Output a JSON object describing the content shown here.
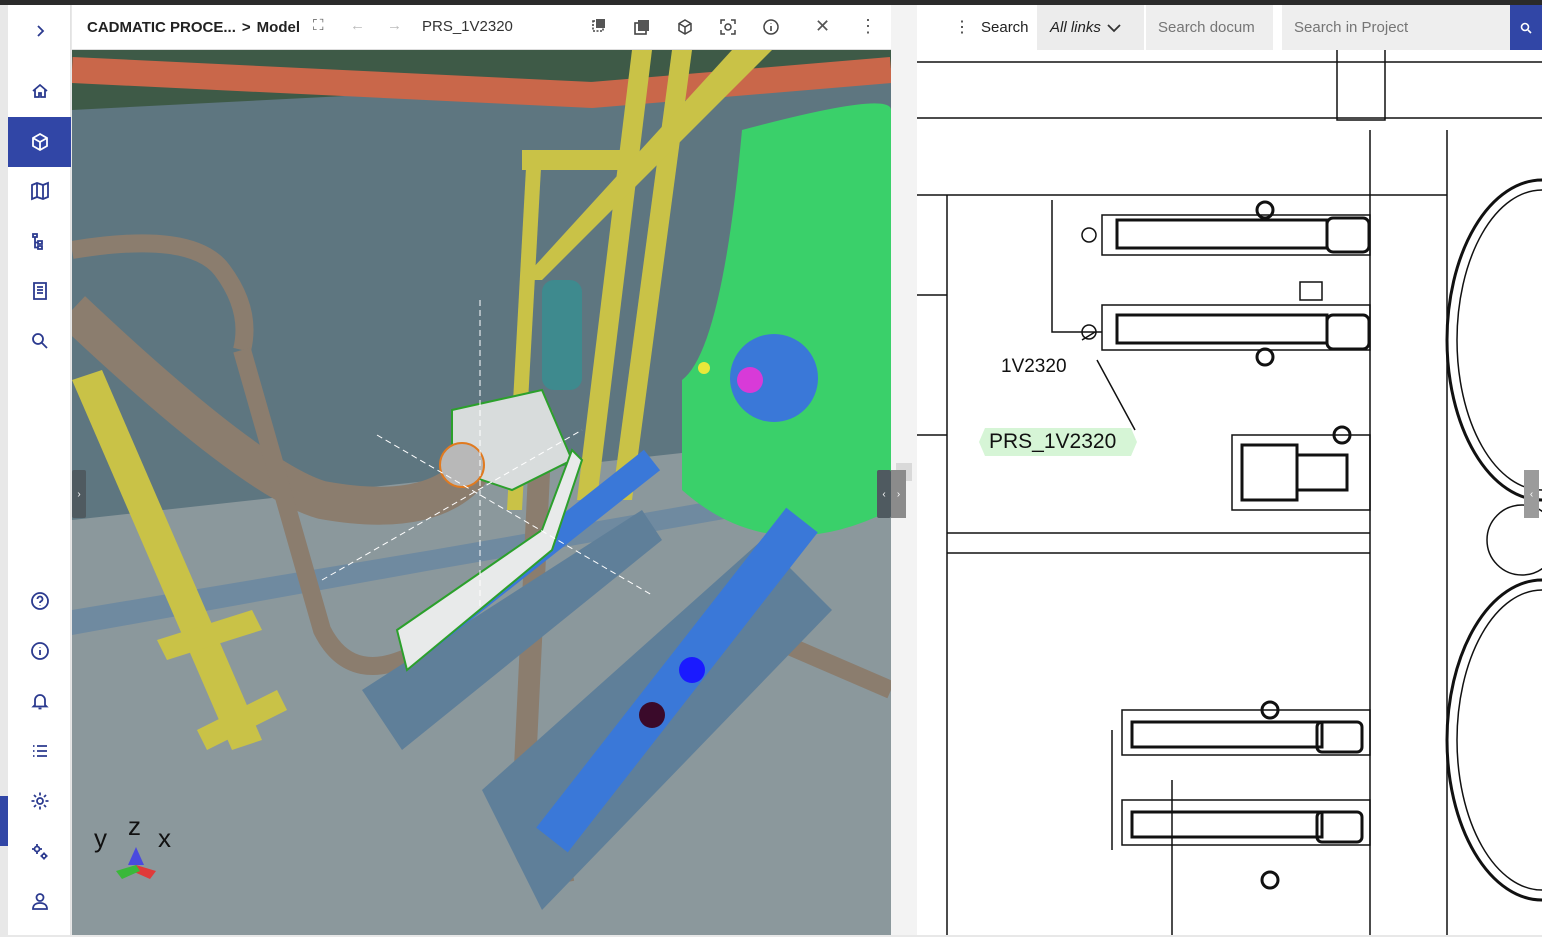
{
  "rail": {
    "expand_icon": "chevron-right-icon",
    "items": [
      {
        "name": "home",
        "icon": "home-icon"
      },
      {
        "name": "model",
        "icon": "cube-icon",
        "active": true
      },
      {
        "name": "map",
        "icon": "map-icon"
      },
      {
        "name": "hierarchy",
        "icon": "tree-icon"
      },
      {
        "name": "documents",
        "icon": "document-icon"
      },
      {
        "name": "search",
        "icon": "search-icon"
      },
      {
        "name": "help",
        "icon": "help-icon"
      },
      {
        "name": "info",
        "icon": "info-icon"
      },
      {
        "name": "notifications",
        "icon": "bell-icon"
      },
      {
        "name": "list",
        "icon": "list-icon"
      },
      {
        "name": "settings",
        "icon": "gear-icon"
      },
      {
        "name": "admin-settings",
        "icon": "gears-icon"
      },
      {
        "name": "account",
        "icon": "user-icon"
      }
    ]
  },
  "model_header": {
    "breadcrumb_root": "CADMATIC PROCE...",
    "breadcrumb_sep": ">",
    "breadcrumb_current": "Model",
    "object_title": "PRS_1V2320"
  },
  "viewport": {
    "axis": {
      "x": "x",
      "y": "y",
      "z": "z"
    }
  },
  "drawing_header": {
    "search_label": "Search",
    "links_filter": "All links",
    "search_document_placeholder": "Search docum",
    "search_project_placeholder": "Search in Project"
  },
  "drawing": {
    "label_id": "1V2320",
    "tag_label": "PRS_1V2320"
  },
  "colors": {
    "accent": "#3146a6",
    "selection": "#2ca02c",
    "tank": "#3ad06a",
    "pump": "#3a78d8",
    "pipe_orange": "#c9674a",
    "steel_yellow": "#c9c247"
  }
}
